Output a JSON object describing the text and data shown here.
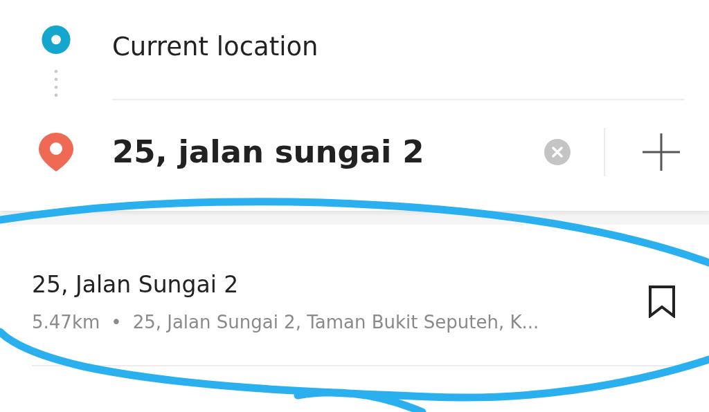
{
  "origin": {
    "text": "Current location"
  },
  "destination": {
    "value": "25, jalan sungai 2"
  },
  "results": [
    {
      "title": "25, Jalan Sungai 2",
      "distance": "5.47km",
      "separator": "•",
      "address": "25, Jalan Sungai 2, Taman Bukit Seputeh, K..."
    }
  ]
}
